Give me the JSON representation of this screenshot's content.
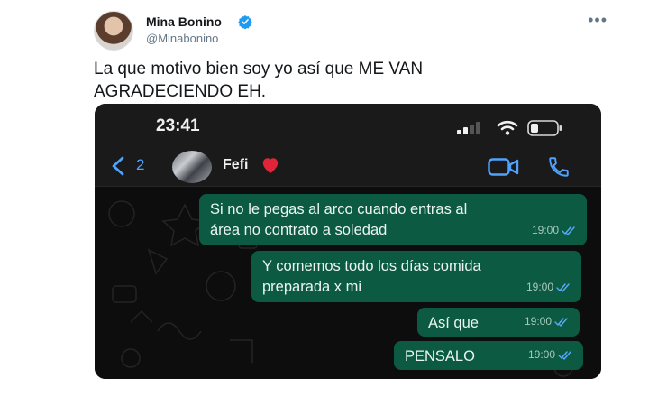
{
  "tweet": {
    "author_name": "Mina Bonino",
    "author_handle": "@Minabonino",
    "text_line1": "La que motivo bien soy yo así que ME VAN",
    "text_line2": "AGRADECIENDO EH.",
    "more_icon": "ellipsis-icon",
    "verified_icon": "verified-badge-icon"
  },
  "phone": {
    "status_time": "23:41",
    "back_count": "2",
    "contact_name": "Fefi",
    "contact_emoji": "❤",
    "icons": [
      "chevron-left-icon",
      "video-call-icon",
      "phone-call-icon",
      "signal-icon",
      "wifi-icon",
      "battery-icon"
    ]
  },
  "messages": [
    {
      "line1": "Si no le pegas al arco cuando entras al",
      "line2": "área no contrato a soledad",
      "time": "19:00"
    },
    {
      "line1": "Y comemos todo los días comida",
      "line2": "preparada x mi",
      "time": "19:00"
    },
    {
      "line1": "Así que",
      "line2": "",
      "time": "19:00"
    },
    {
      "line1": "PENSALO",
      "line2": "",
      "time": "19:00"
    }
  ],
  "colors": {
    "outgoing_bubble": "#0b5a41",
    "accent_blue": "#4fa3ff",
    "verified_blue": "#1d9bf0",
    "chat_background": "#0d0d0d"
  }
}
